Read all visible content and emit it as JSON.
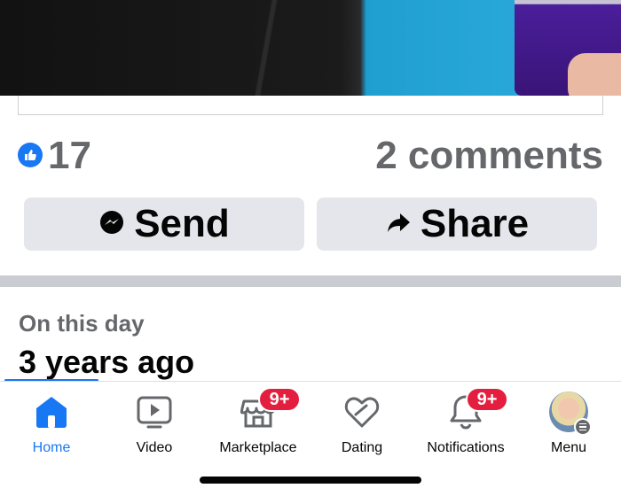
{
  "post": {
    "like_count": "17",
    "comments_label": "2 comments",
    "send_label": "Send",
    "share_label": "Share"
  },
  "memories": {
    "title": "On this day",
    "subtitle": "3 years ago"
  },
  "tabbar": {
    "tabs": [
      {
        "label": "Home",
        "icon": "home-icon",
        "active": true
      },
      {
        "label": "Video",
        "icon": "video-icon"
      },
      {
        "label": "Marketplace",
        "icon": "marketplace-icon",
        "badge": "9+"
      },
      {
        "label": "Dating",
        "icon": "dating-icon"
      },
      {
        "label": "Notifications",
        "icon": "bell-icon",
        "badge": "9+"
      },
      {
        "label": "Menu",
        "icon": "avatar"
      }
    ]
  },
  "colors": {
    "accent": "#1877f2",
    "badge": "#e41e3f",
    "secondary_text": "#65676b",
    "button_bg": "#e4e6eb"
  }
}
